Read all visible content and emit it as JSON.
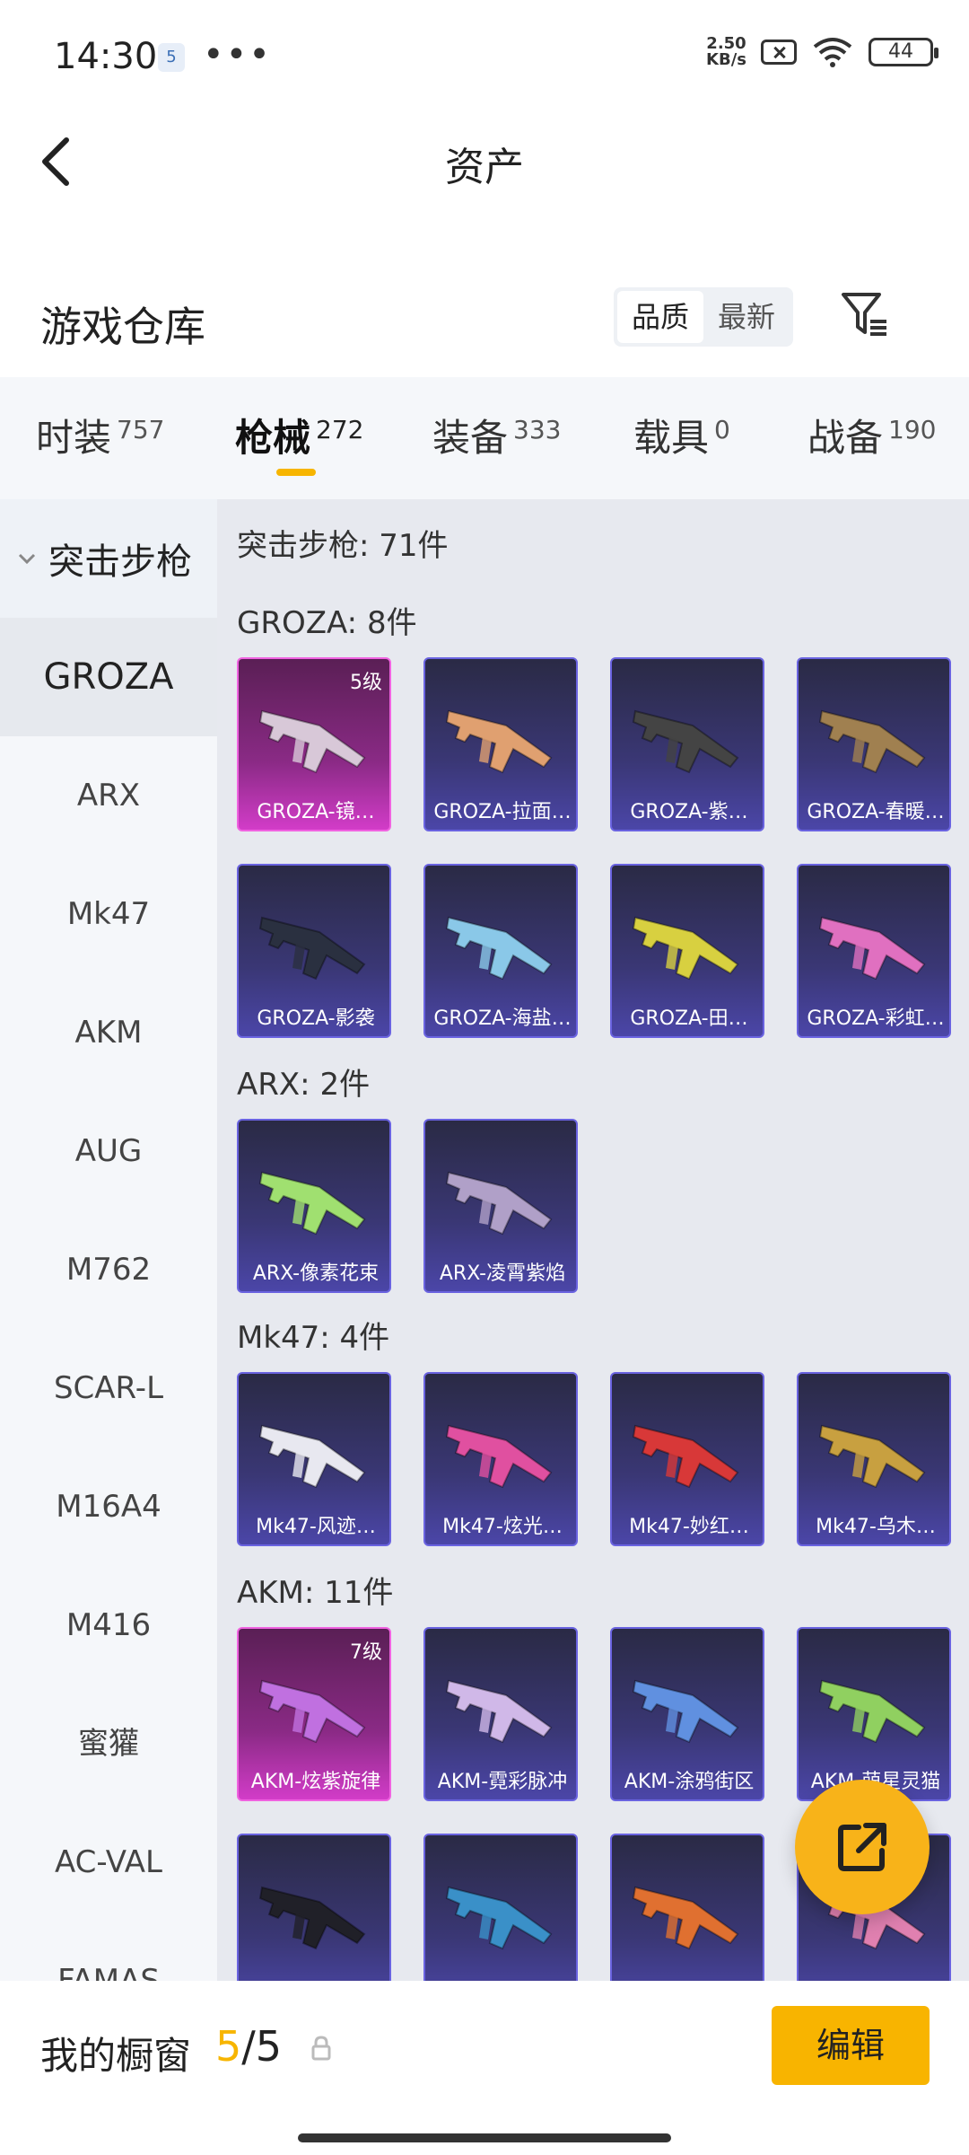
{
  "status_bar": {
    "time": "14:30",
    "notification": "5",
    "dots": "•••",
    "speed_value": "2.50",
    "speed_unit": "KB/s",
    "battery": "44"
  },
  "header": {
    "title": "资产"
  },
  "warehouse": {
    "title": "游戏仓库",
    "sort_options": [
      "品质",
      "最新"
    ]
  },
  "category_tabs": [
    {
      "label": "时装",
      "count": "757"
    },
    {
      "label": "枪械",
      "count": "272"
    },
    {
      "label": "装备",
      "count": "333"
    },
    {
      "label": "载具",
      "count": "0"
    },
    {
      "label": "战备",
      "count": "190"
    }
  ],
  "active_tab_index": 1,
  "sidebar": {
    "group": "突击步枪",
    "items": [
      "GROZA",
      "ARX",
      "Mk47",
      "AKM",
      "AUG",
      "M762",
      "SCAR-L",
      "M16A4",
      "M416",
      "蜜獾",
      "AC-VAL",
      "FAMAS"
    ]
  },
  "content": {
    "category_summary": "突击步枪: 71件",
    "sections": [
      {
        "title": "GROZA: 8件",
        "items": [
          {
            "label": "GROZA-镜…",
            "level": "5级",
            "rarity": "gold",
            "gun_color": "#d8c8d8"
          },
          {
            "label": "GROZA-拉面…",
            "level": "",
            "rarity": "purple",
            "gun_color": "#e0a070"
          },
          {
            "label": "GROZA-紫…",
            "level": "",
            "rarity": "purple",
            "gun_color": "#444444"
          },
          {
            "label": "GROZA-春暖…",
            "level": "",
            "rarity": "purple",
            "gun_color": "#a08050"
          },
          {
            "label": "GROZA-影袭",
            "level": "",
            "rarity": "purple",
            "gun_color": "#2a3040"
          },
          {
            "label": "GROZA-海盐…",
            "level": "",
            "rarity": "purple",
            "gun_color": "#8ac8e8"
          },
          {
            "label": "GROZA-田…",
            "level": "",
            "rarity": "purple",
            "gun_color": "#d8d040"
          },
          {
            "label": "GROZA-彩虹…",
            "level": "",
            "rarity": "purple",
            "gun_color": "#e070c0"
          }
        ]
      },
      {
        "title": "ARX: 2件",
        "items": [
          {
            "label": "ARX-像素花束",
            "level": "",
            "rarity": "purple",
            "gun_color": "#a0e070"
          },
          {
            "label": "ARX-凌霄紫焰",
            "level": "",
            "rarity": "purple",
            "gun_color": "#b0a0c8"
          }
        ]
      },
      {
        "title": "Mk47: 4件",
        "items": [
          {
            "label": "Mk47-风迹…",
            "level": "",
            "rarity": "purple",
            "gun_color": "#e8e8f0"
          },
          {
            "label": "Mk47-炫光…",
            "level": "",
            "rarity": "purple",
            "gun_color": "#e050a0"
          },
          {
            "label": "Mk47-妙红…",
            "level": "",
            "rarity": "purple",
            "gun_color": "#d83838"
          },
          {
            "label": "Mk47-乌木…",
            "level": "",
            "rarity": "purple",
            "gun_color": "#c8a040"
          }
        ]
      },
      {
        "title": "AKM: 11件",
        "items": [
          {
            "label": "AKM-炫紫旋律",
            "level": "7级",
            "rarity": "gold",
            "gun_color": "#c070e0"
          },
          {
            "label": "AKM-霓彩脉冲",
            "level": "",
            "rarity": "purple",
            "gun_color": "#d0b8e8"
          },
          {
            "label": "AKM-涂鸦街区",
            "level": "",
            "rarity": "purple",
            "gun_color": "#6090e0"
          },
          {
            "label": "AKM-萌星灵猫",
            "level": "",
            "rarity": "purple",
            "gun_color": "#90d060"
          },
          {
            "label": "",
            "level": "",
            "rarity": "purple",
            "gun_color": "#202028"
          },
          {
            "label": "",
            "level": "",
            "rarity": "purple",
            "gun_color": "#3a90c8"
          },
          {
            "label": "",
            "level": "",
            "rarity": "purple",
            "gun_color": "#e07030"
          },
          {
            "label": "",
            "level": "",
            "rarity": "purple",
            "gun_color": "#e080b0"
          }
        ]
      }
    ]
  },
  "bottom_bar": {
    "label": "我的橱窗",
    "current": "5",
    "separator": "/",
    "total": "5",
    "edit_label": "编辑"
  },
  "colors": {
    "accent": "#f8b400",
    "tile_purple": "#3a3775",
    "tile_gold": "#d23cc8"
  }
}
